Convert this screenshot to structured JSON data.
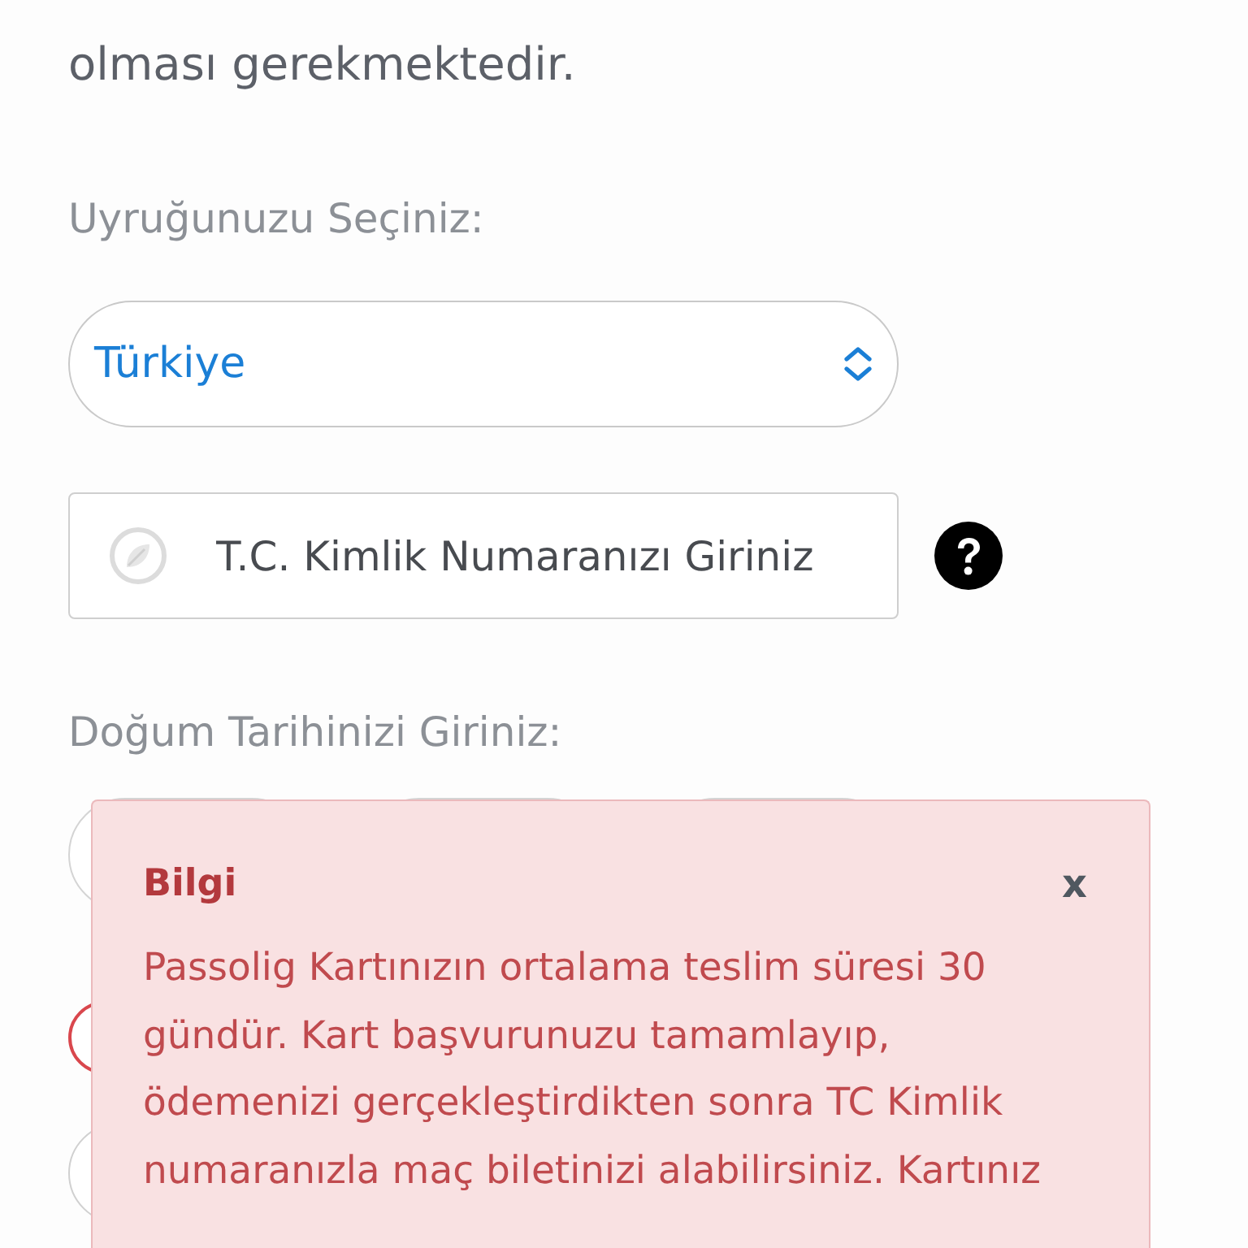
{
  "intro": {
    "text": "olması gerekmektedir."
  },
  "nationality": {
    "label": "Uyruğunuzu Seçiniz:",
    "value": "Türkiye"
  },
  "id_field": {
    "placeholder": "T.C. Kimlik Numaranızı Giriniz"
  },
  "birth_date": {
    "label": "Doğum Tarihinizi Giriniz:"
  },
  "option_circles": [
    {
      "invalid": true
    },
    {
      "invalid": false
    }
  ],
  "alert": {
    "title": "Bilgi",
    "close": "x",
    "message": "Passolig Kartınızın ortalama teslim süresi 30 gündür. Kart başvurunuzu tamamlayıp, ödemenizi gerçekleştirdikten sonra TC Kimlik numaranızla maç biletinizi alabilirsiniz. Kartınız"
  }
}
